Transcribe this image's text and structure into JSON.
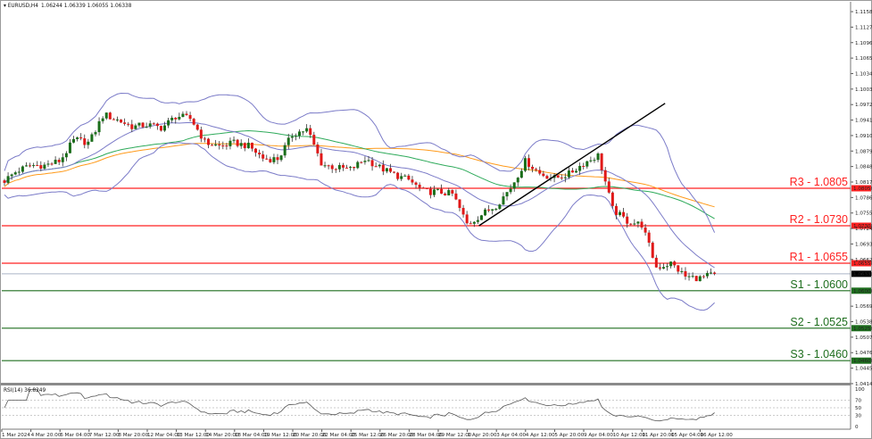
{
  "header": {
    "symbol": "EURUSD,H4",
    "ohlc": "1.06244 1.06339 1.06055 1.06338"
  },
  "rsi_label": "RSI(14) 36.8249",
  "chart_data": {
    "type": "candlestick",
    "symbol": "EURUSD",
    "timeframe": "H4",
    "y_axis_ticks": [
      "1.11585",
      "1.11275",
      "1.10965",
      "1.10655",
      "1.10345",
      "1.10035",
      "1.09725",
      "1.09415",
      "1.09105",
      "1.08795",
      "1.08485",
      "1.08175",
      "1.07865",
      "1.07555",
      "1.07245",
      "1.06935",
      "1.06625",
      "1.05690",
      "1.05380",
      "1.05070",
      "1.04760",
      "1.04450",
      "1.04140"
    ],
    "ylim": [
      1.0414,
      1.1173
    ],
    "x_ticks": [
      "1 Mar 2024",
      "4 Mar 20:00",
      "6 Mar 04:00",
      "7 Mar 12:00",
      "8 Mar 20:00",
      "12 Mar 04:00",
      "13 Mar 12:00",
      "14 Mar 20:00",
      "18 Mar 04:00",
      "19 Mar 12:00",
      "20 Mar 20:00",
      "22 Mar 04:00",
      "25 Mar 12:00",
      "26 Mar 20:00",
      "28 Mar 04:00",
      "29 Mar 12:00",
      "1 Apr 20:00",
      "3 Apr 04:00",
      "4 Apr 12:00",
      "5 Apr 20:00",
      "9 Apr 04:00",
      "10 Apr 12:00",
      "11 Apr 20:00",
      "15 Apr 04:00",
      "16 Apr 12:00"
    ],
    "close_samples_half_tick": [
      1.0816,
      1.0839,
      1.0851,
      1.0851,
      1.086,
      1.0903,
      1.0896,
      1.0953,
      1.0941,
      1.0928,
      1.0932,
      1.0926,
      1.095,
      1.0944,
      1.0896,
      1.0889,
      1.0896,
      1.0889,
      1.0864,
      1.0864,
      1.0914,
      1.0923,
      1.0853,
      1.0846,
      1.0843,
      1.0864,
      1.0846,
      1.0832,
      1.0821,
      1.0798,
      1.0798,
      1.0793,
      1.0732,
      1.0753,
      1.0771,
      1.0807,
      1.086,
      1.0834,
      1.0825,
      1.0834,
      1.0855,
      1.0871,
      1.0762,
      1.0739,
      1.0732,
      1.0646,
      1.0655,
      1.0628,
      1.0625,
      1.06338
    ],
    "current_price": {
      "value": 1.06338,
      "label": "1.06338"
    },
    "levels": [
      {
        "name": "R3",
        "text": "R3 - 1.0805",
        "value": 1.0805,
        "tag": "1.08050",
        "color": "#ff2020"
      },
      {
        "name": "R2",
        "text": "R2 - 1.0730",
        "value": 1.073,
        "tag": "1.07300",
        "color": "#ff2020"
      },
      {
        "name": "R1",
        "text": "R1 - 1.0655",
        "value": 1.0655,
        "tag": "1.06550",
        "color": "#ff2020"
      },
      {
        "name": "S1",
        "text": "S1 - 1.0600",
        "value": 1.06,
        "tag": "1.06000",
        "color": "#1e6e1e"
      },
      {
        "name": "S2",
        "text": "S2 - 1.0525",
        "value": 1.0525,
        "tag": "1.05250",
        "color": "#1e6e1e"
      },
      {
        "name": "S3",
        "text": "S3 - 1.0460",
        "value": 1.046,
        "tag": "1.04600",
        "color": "#1e6e1e"
      }
    ],
    "trendline": {
      "from": [
        "2 Apr 08:00",
        1.073
      ],
      "to": [
        "15 Apr 00:00",
        1.0975
      ],
      "color": "#000000"
    },
    "indicators": {
      "bollinger": {
        "period": 20,
        "deviations": 2,
        "color": "#7b7bc8"
      },
      "ma_fast": {
        "period": 50,
        "color": "#2eaa5a"
      },
      "ma_slow": {
        "period": 100,
        "color": "#ff9a1a"
      },
      "rsi": {
        "period": 14,
        "value": 36.8249,
        "levels": [
          70,
          50,
          30
        ],
        "ticks": [
          "100",
          "70",
          "50",
          "30",
          "0"
        ],
        "ylim": [
          0,
          100
        ]
      }
    },
    "colors": {
      "bull": "#1a6e1a",
      "bear": "#e01818",
      "grid_current": "#aab4c8"
    }
  }
}
